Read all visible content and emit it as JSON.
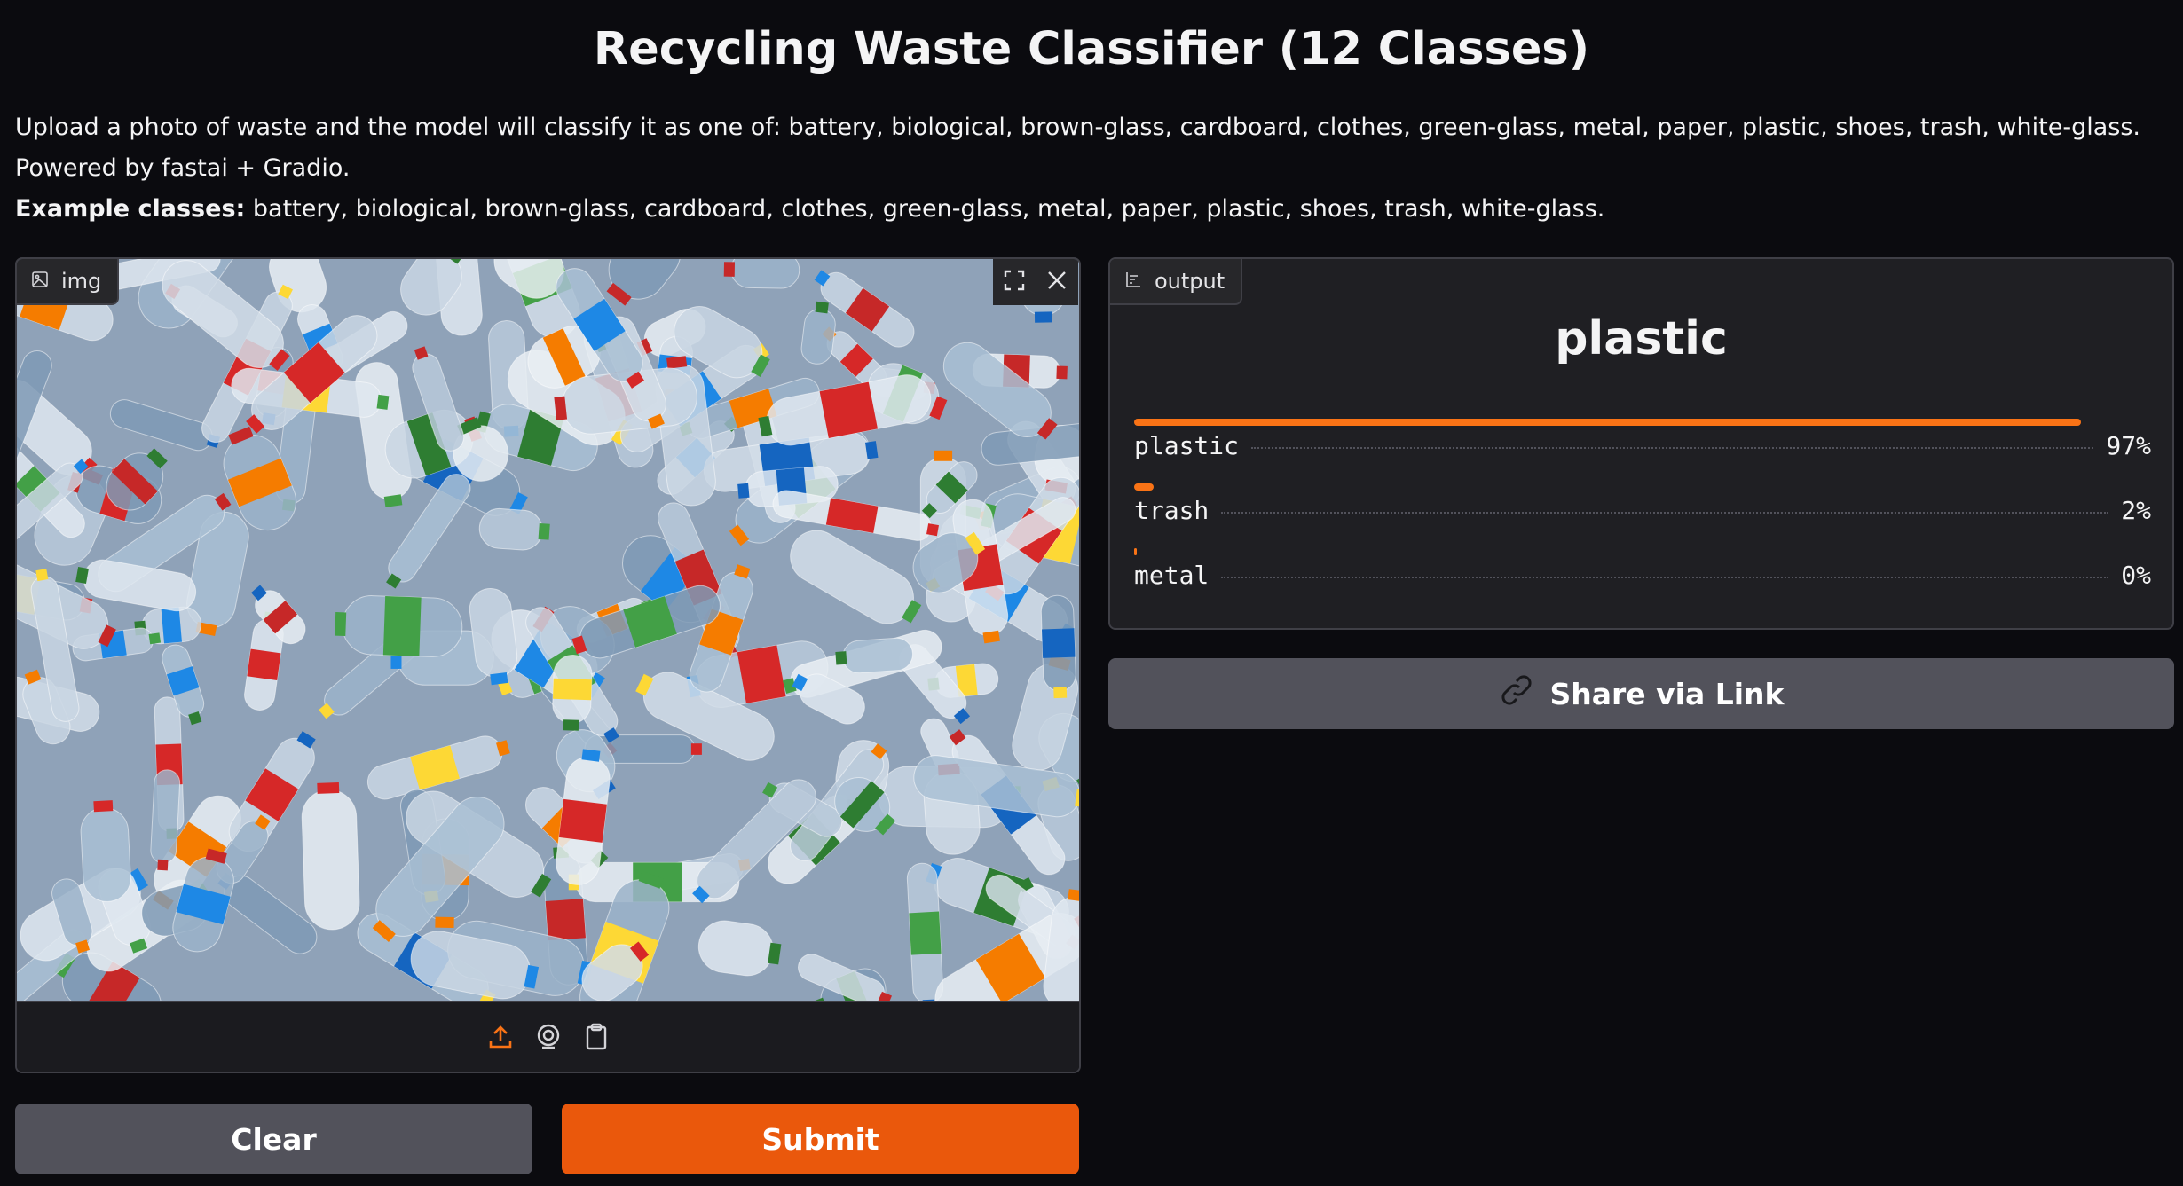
{
  "header": {
    "title": "Recycling Waste Classifier (12 Classes)",
    "description": "Upload a photo of waste and the model will classify it as one of: battery, biological, brown-glass, cardboard, clothes, green-glass, metal, paper, plastic, shoes, trash, white-glass.",
    "powered_by": "Powered by fastai + Gradio.",
    "examples_label": "Example classes:",
    "examples_text": " battery, biological, brown-glass, cardboard, clothes, green-glass, metal, paper, plastic, shoes, trash, white-glass."
  },
  "input": {
    "label": "img",
    "icons": [
      "image-icon",
      "fullscreen-icon",
      "close-icon",
      "upload-icon",
      "webcam-icon",
      "clipboard-icon"
    ]
  },
  "buttons": {
    "clear": "Clear",
    "submit": "Submit",
    "share": "Share via Link"
  },
  "output": {
    "label": "output",
    "top_label": "plastic",
    "confidences": [
      {
        "label": "plastic",
        "percent": "97%",
        "value": 0.97
      },
      {
        "label": "trash",
        "percent": "2%",
        "value": 0.02
      },
      {
        "label": "metal",
        "percent": "0%",
        "value": 0.0
      }
    ]
  },
  "colors": {
    "accent": "#ea580c",
    "bar": "#f97316",
    "secondary_button": "#52525b",
    "background": "#0b0b0f"
  }
}
